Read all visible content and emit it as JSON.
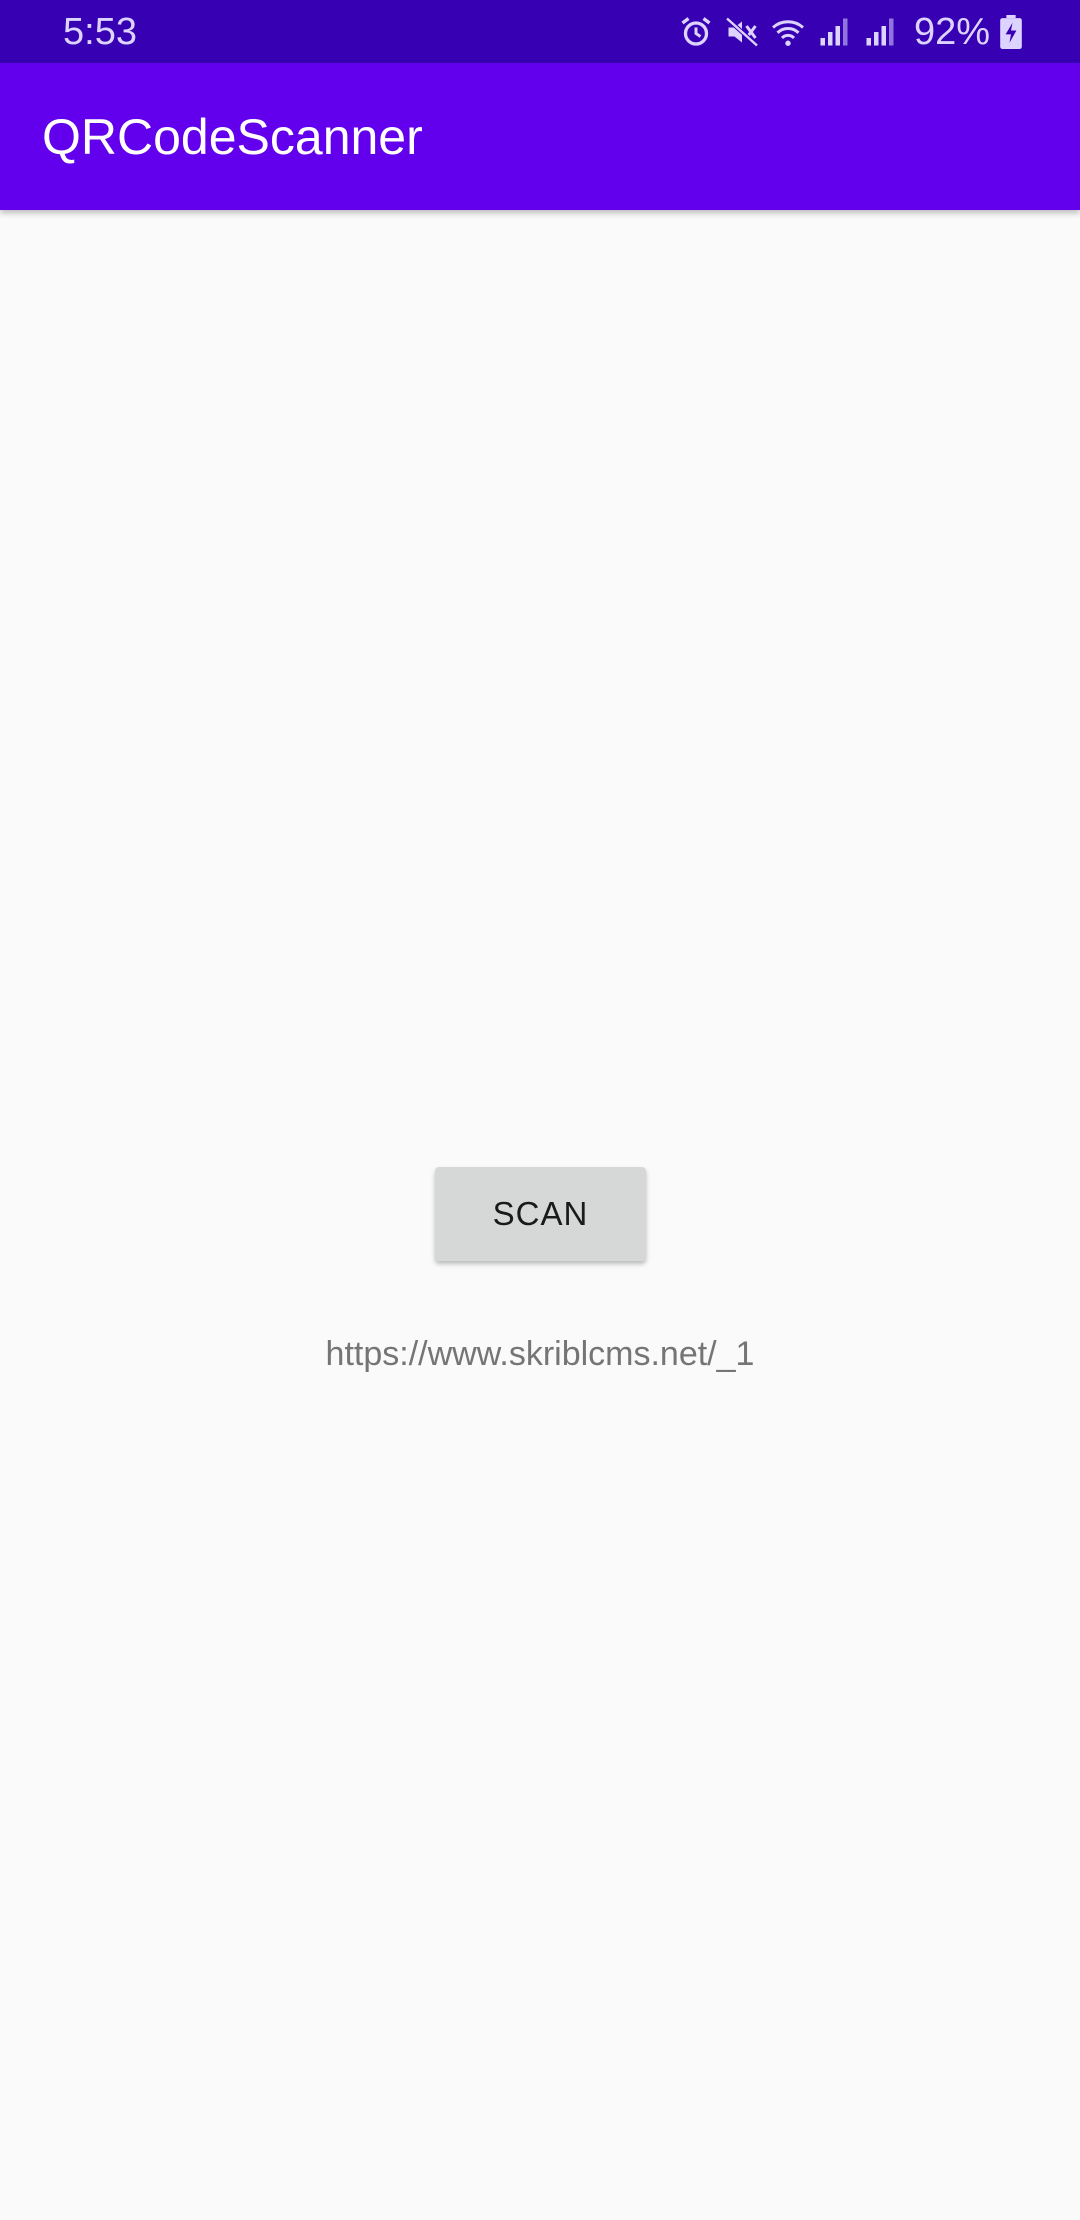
{
  "status_bar": {
    "time": "5:53",
    "battery_percent": "92%",
    "icons": [
      "alarm-icon",
      "mute-icon",
      "wifi-icon",
      "signal-icon",
      "signal-icon",
      "battery-charging-icon"
    ]
  },
  "app_bar": {
    "title": "QRCodeScanner"
  },
  "main": {
    "scan_button_label": "SCAN",
    "result_text": "https://www.skriblcms.net/_1"
  },
  "colors": {
    "status_bar": "#3700b3",
    "app_bar": "#6200ee",
    "background": "#fafafa",
    "button": "#d6d7d7"
  }
}
